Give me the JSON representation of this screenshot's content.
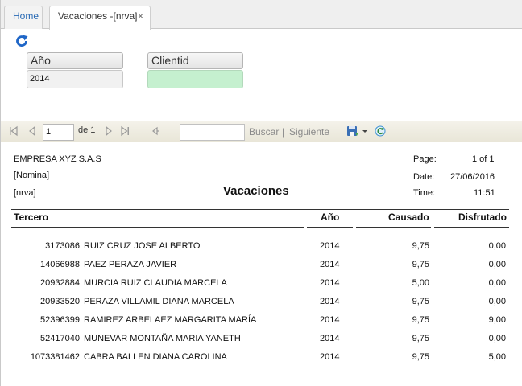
{
  "tabs": {
    "home": "Home",
    "active": "Vacaciones -[nrva]",
    "close": "×"
  },
  "params": {
    "year_label": "Año",
    "year_value": "2014",
    "client_label": "Clientid",
    "client_value": ""
  },
  "toolbar": {
    "page_value": "1",
    "page_of": "de 1",
    "find_placeholder": "",
    "find_label": "Buscar",
    "separator": "|",
    "next_label": "Siguiente"
  },
  "report": {
    "company": "EMPRESA XYZ S.A.S",
    "module": "[Nomina]",
    "code": "[nrva]",
    "title": "Vacaciones",
    "page_label": "Page:",
    "page_value": "1 of 1",
    "date_label": "Date:",
    "date_value": "27/06/2016",
    "time_label": "Time:",
    "time_value": "11:51",
    "columns": {
      "tercero": "Tercero",
      "anio": "Año",
      "causado": "Causado",
      "disfrutado": "Disfrutado"
    },
    "rows": [
      {
        "id": "3173086",
        "name": "RUIZ CRUZ JOSE ALBERTO",
        "year": "2014",
        "causado": "9,75",
        "disfrutado": "0,00"
      },
      {
        "id": "14066988",
        "name": "PAEZ PERAZA JAVIER",
        "year": "2014",
        "causado": "9,75",
        "disfrutado": "0,00"
      },
      {
        "id": "20932884",
        "name": "MURCIA RUIZ CLAUDIA MARCELA",
        "year": "2014",
        "causado": "5,00",
        "disfrutado": "0,00"
      },
      {
        "id": "20933520",
        "name": "PERAZA VILLAMIL DIANA MARCELA",
        "year": "2014",
        "causado": "9,75",
        "disfrutado": "0,00"
      },
      {
        "id": "52396399",
        "name": "RAMIREZ ARBELAEZ MARGARITA MARÍA",
        "year": "2014",
        "causado": "9,75",
        "disfrutado": "9,00"
      },
      {
        "id": "52417040",
        "name": "MUNEVAR MONTAÑA MARIA YANETH",
        "year": "2014",
        "causado": "9,75",
        "disfrutado": "0,00"
      },
      {
        "id": "1073381462",
        "name": "CABRA BALLEN DIANA CAROLINA",
        "year": "2014",
        "causado": "9,75",
        "disfrutado": "5,00"
      }
    ]
  },
  "colors": {
    "link": "#2a6bb5",
    "accent_green": "#c5f0cf",
    "toolbar_bg": "#efece0"
  },
  "icons": [
    "refresh-icon",
    "first-page-icon",
    "prev-page-icon",
    "next-page-icon",
    "last-page-icon",
    "back-icon",
    "save-icon",
    "dropdown-icon",
    "reload-icon"
  ]
}
